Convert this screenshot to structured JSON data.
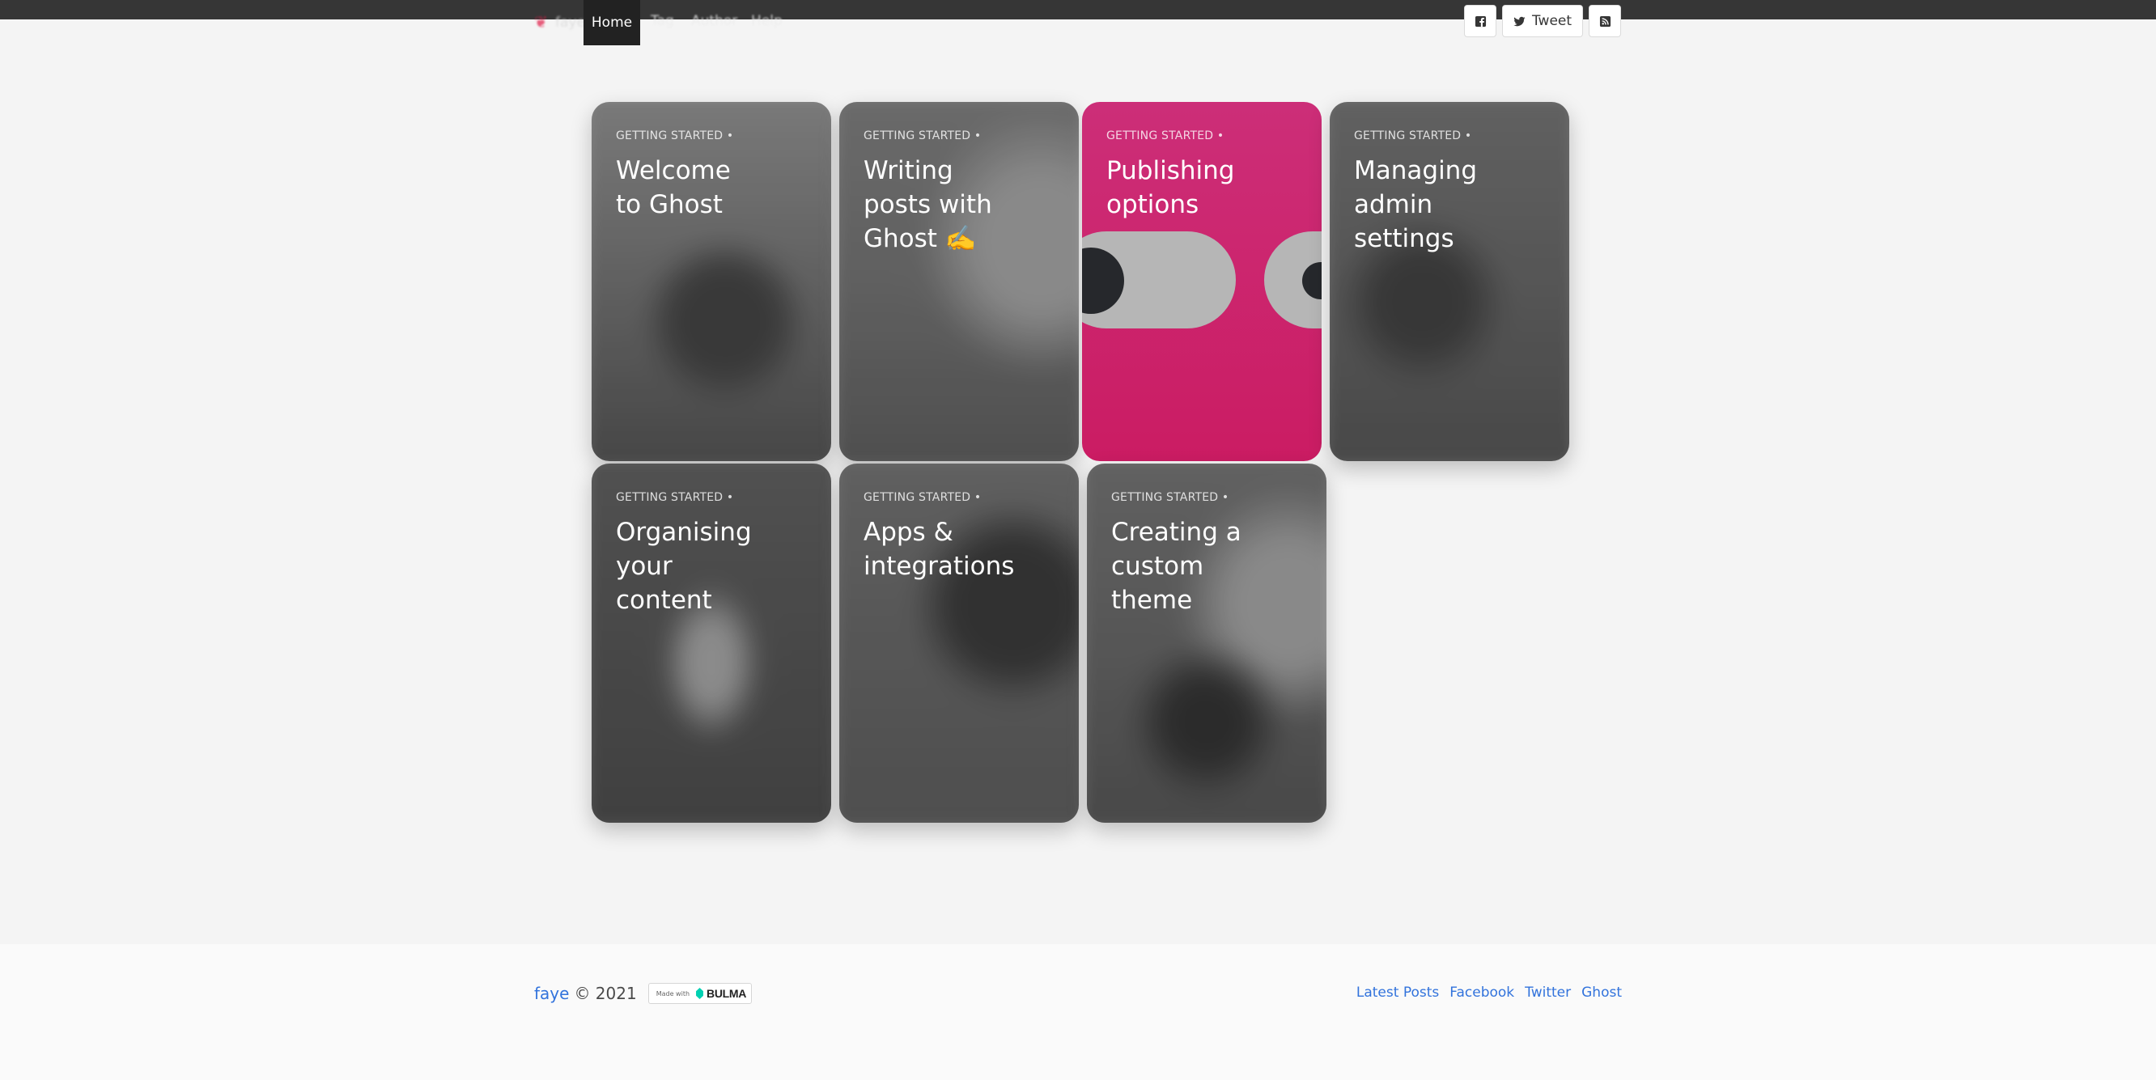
{
  "nav": {
    "brand": "faye",
    "items": [
      {
        "label": "Home",
        "active": true
      },
      {
        "label": "Tag",
        "active": false
      },
      {
        "label": "Author",
        "active": false
      },
      {
        "label": "Help",
        "active": false
      }
    ]
  },
  "share": {
    "facebook_icon": "facebook-square-icon",
    "tweet_label": "Tweet",
    "rss_icon": "rss-square-icon"
  },
  "cards": [
    {
      "tag": "GETTING STARTED •",
      "title": "Welcome to Ghost",
      "highlighted": false
    },
    {
      "tag": "GETTING STARTED •",
      "title": "Writing posts with Ghost ✍️",
      "highlighted": false
    },
    {
      "tag": "GETTING STARTED •",
      "title": "Publishing options",
      "highlighted": true
    },
    {
      "tag": "GETTING STARTED •",
      "title": "Managing admin settings",
      "highlighted": false
    },
    {
      "tag": "GETTING STARTED •",
      "title": "Organising your content",
      "highlighted": false
    },
    {
      "tag": "GETTING STARTED •",
      "title": "Apps & integrations",
      "highlighted": false
    },
    {
      "tag": "GETTING STARTED •",
      "title": "Creating a custom theme",
      "highlighted": false
    }
  ],
  "footer": {
    "site": "faye",
    "copyright": "© 2021",
    "badge_prefix": "Made with",
    "badge_word": "BULMA",
    "links": [
      "Latest Posts",
      "Facebook",
      "Twitter",
      "Ghost"
    ]
  },
  "colors": {
    "accent_pink": "#cc2e78",
    "link": "#3273dc",
    "nav_bg": "#363636"
  }
}
